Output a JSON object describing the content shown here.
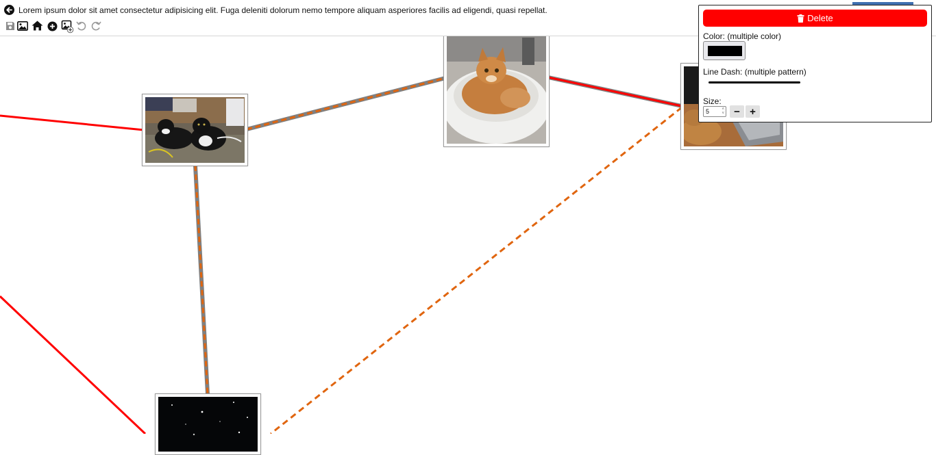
{
  "header": {
    "description": "Lorem ipsum dolor sit amet consectetur adipisicing elit. Fuga deleniti dolorum nemo tempore aliquam asperiores facilis ad eligendi, quasi repellat."
  },
  "toolbar": {
    "icons": [
      "save-icon",
      "image-icon",
      "home-icon",
      "add-circle-icon",
      "add-image-icon",
      "undo-icon",
      "redo-icon"
    ]
  },
  "properties_panel": {
    "delete_label": "Delete",
    "color_label": "Color: (multiple color)",
    "color_value": "#000000",
    "line_dash_label": "Line Dash: (multiple pattern)",
    "size_label": "Size:",
    "size_value": "5",
    "decrement_symbol": "−",
    "increment_symbol": "+"
  },
  "colors": {
    "accent_red": "#ff0000",
    "edge_gray": "#808080",
    "edge_orange": "#e0650f",
    "panel_border": "#222222"
  }
}
